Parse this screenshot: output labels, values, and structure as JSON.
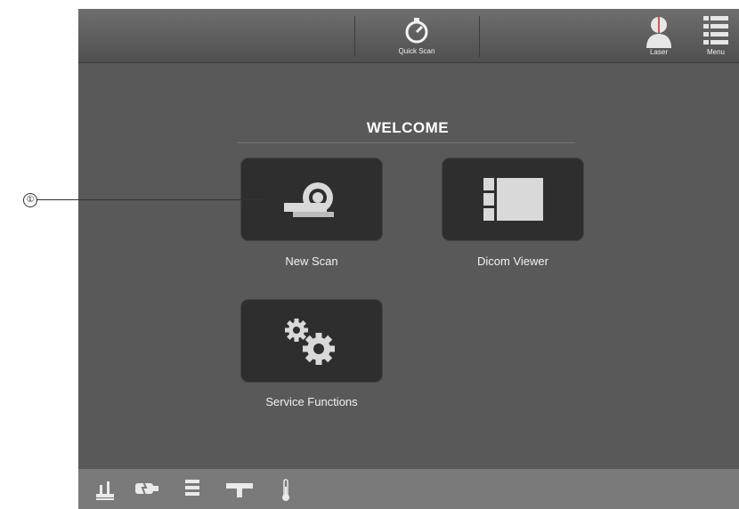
{
  "callout": {
    "number": "①"
  },
  "topbar": {
    "quick_scan_label": "Quick Scan",
    "laser_label": "Laser",
    "menu_label": "Menu"
  },
  "main": {
    "heading": "WELCOME",
    "tiles": [
      {
        "label": "New Scan",
        "icon": "scanner-icon"
      },
      {
        "label": "Dicom Viewer",
        "icon": "dicom-viewer-icon"
      },
      {
        "label": "Service Functions",
        "icon": "gears-icon"
      }
    ]
  },
  "statusbar": {
    "icons": [
      "patient-table-icon",
      "tube-icon",
      "detector-icon",
      "laser-beam-icon",
      "thermometer-icon"
    ]
  },
  "colors": {
    "screen_bg": "#595959",
    "tile_bg": "#2e2e2e",
    "statusbar_bg": "#7a7a7a"
  }
}
